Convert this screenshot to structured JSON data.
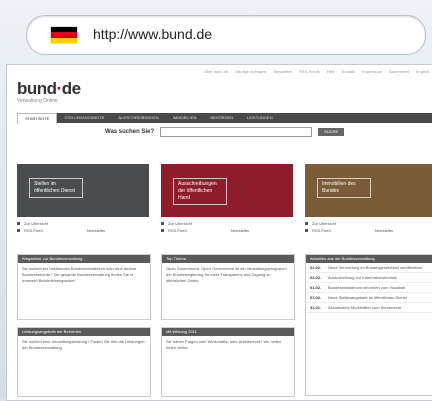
{
  "browser": {
    "url": "http://www.bund.de",
    "flag_colors": [
      "#000000",
      "#dd0000",
      "#ffce00"
    ]
  },
  "site": {
    "toplinks": [
      "Über bund.de",
      "Häufige Anfragen",
      "Newsletter",
      "RSS-Feeds",
      "Hilfe",
      "Kontakt",
      "Impressum",
      "Barrierefrei",
      "English"
    ],
    "logo_main": "bund",
    "logo_dot": "·",
    "logo_tail": "de",
    "logo_sub": "Verwaltung Online",
    "nav": [
      "STARTSEITE",
      "STELLENANGEBOTE",
      "AUSSCHREIBUNGEN",
      "IMMOBILIEN",
      "BEHÖRDEN",
      "LEISTUNGEN"
    ],
    "search": {
      "label": "Was suchen Sie?",
      "button": "SUCHE"
    },
    "banners": [
      {
        "title": "Stellen im öffentlichen Dienst",
        "links": [
          "Zur Übersicht",
          "RSS-Feed",
          "Newsletter"
        ]
      },
      {
        "title": "Ausschreibungen der öffentlichen Hand",
        "links": [
          "Zur Übersicht",
          "RSS-Feed",
          "Newsletter"
        ]
      },
      {
        "title": "Immobilien des Bundes",
        "links": [
          "Zur Übersicht",
          "RSS-Feed",
          "Newsletter"
        ]
      }
    ],
    "boxes": [
      {
        "title": "Wegweiser zur Bundesverwaltung",
        "body": "Sie suchen ein bestimmtes Bundesministerium oder eine andere Bundesbehörde? Die gesamte Bundesverwaltung finden Sie in unserem Behördenwegweiser."
      },
      {
        "title": "Top Thema",
        "body": "Open Government. Open Government ist ein Verwaltungsprogramm der Bundesregierung für mehr Transparenz und Zugang zu öffentlichen Daten."
      },
      {
        "title": "Leistungsangebote der Behörden",
        "body": "Sie suchen eine Verwaltungsleistung? Finden Sie hier die Leistungen der Bundesverwaltung."
      },
      {
        "title": "Mit Wirkung 2011",
        "body": "Sie haben Fragen zum Wirtschafts- oder Arbeitsrecht? Wir helfen Ihnen weiter."
      }
    ],
    "news": {
      "title": "Aktuelles aus der Bundesverwaltung",
      "items": [
        {
          "date": "02.02.",
          "text": "Neue Verordnung im Bundesgesetzblatt veröffentlicht"
        },
        {
          "date": "02.02.",
          "text": "Ausschreibung zur Informationstechnik"
        },
        {
          "date": "01.02.",
          "text": "Bundesministerium informiert zum Haushalt"
        },
        {
          "date": "01.02.",
          "text": "Neue Stellenangebote im öffentlichen Dienst"
        },
        {
          "date": "31.01.",
          "text": "Aktualisierte Merkblätter zum Steuerrecht"
        }
      ]
    }
  }
}
